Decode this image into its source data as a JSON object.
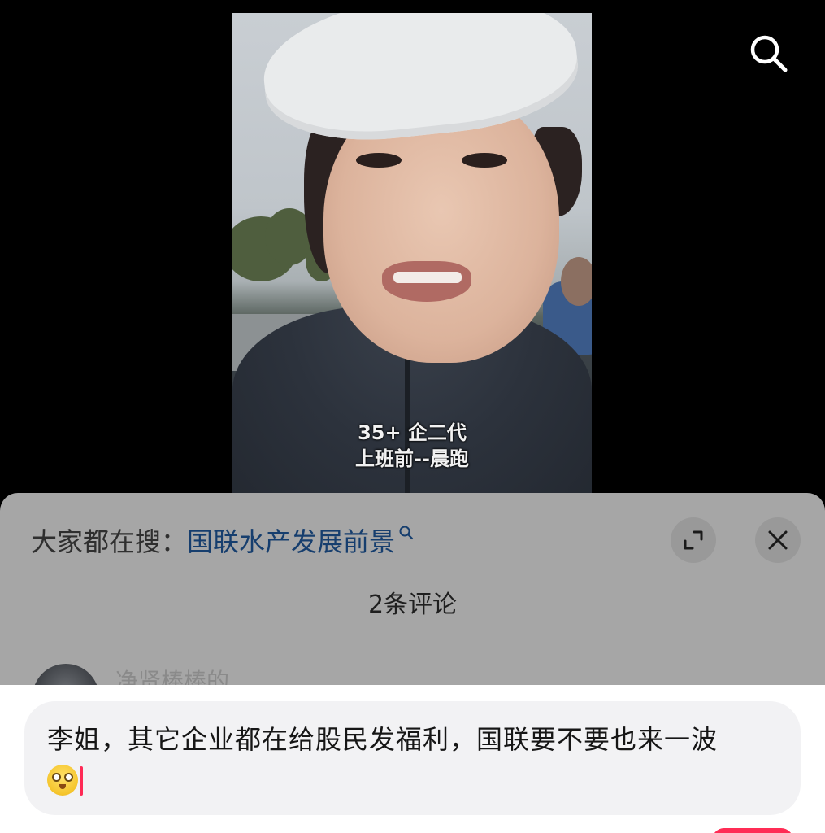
{
  "video": {
    "caption_line1": "35+ 企二代",
    "caption_line2": "上班前--晨跑"
  },
  "top_bar": {
    "search_icon": "search-icon"
  },
  "comment_sheet": {
    "hot_search_label": "大家都在搜：",
    "hot_search_term": "国联水产发展前景",
    "comment_count": "2条评论",
    "expand_icon": "expand-icon",
    "close_icon": "close-icon",
    "first_comment": {
      "username": "净贤棒棒的"
    }
  },
  "input": {
    "text": "李姐，其它企业都在给股民发福利，国联要不要也来一波",
    "emoji": "smiling-face-emoji"
  },
  "colors": {
    "sheet_bg": "#a6a6a6",
    "link": "#163e6e",
    "caret": "#ff2a55",
    "send_button": "#ff2c55"
  }
}
